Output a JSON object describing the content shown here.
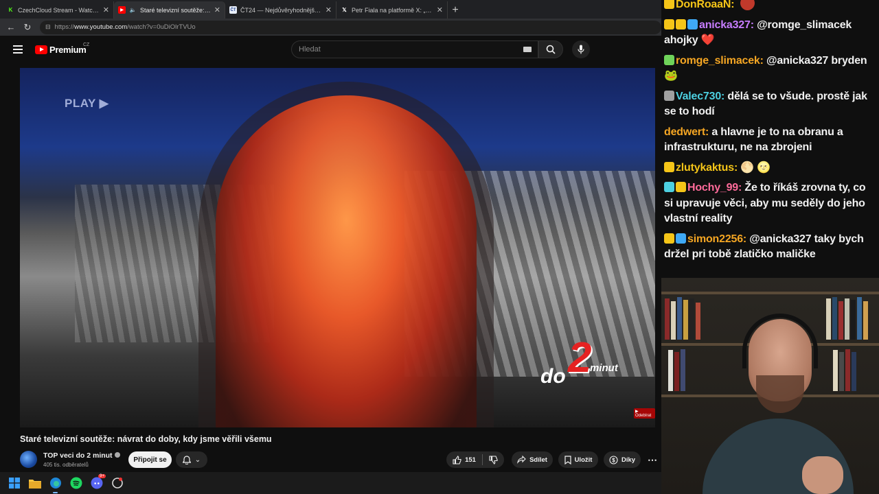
{
  "browser": {
    "tabs": [
      {
        "title": "CzechCloud Stream - Watch Live o",
        "icon": "kick-icon",
        "color": "#53fc18",
        "active": false
      },
      {
        "title": "Staré televizní soutěže: návrat",
        "icon": "youtube-icon",
        "color": "#ff0000",
        "active": true
      },
      {
        "title": "ČT24 — Nejdůvěryhodnější zprav",
        "icon": "ct24-icon",
        "color": "#4a7bd0",
        "active": false
      },
      {
        "title": "Petr Fiala na platformě X: „100 dní",
        "icon": "x-icon",
        "color": "#ffffff",
        "active": false
      }
    ],
    "url_prefix": "https://",
    "url_host": "www.youtube.com",
    "url_path": "/watch?v=0uDiOlrTVUo"
  },
  "youtube": {
    "logo_text": "Premium",
    "country": "CZ",
    "search_placeholder": "Hledat"
  },
  "video": {
    "overlay_play": "PLAY ▶",
    "logo_do": "do",
    "logo_two": "2",
    "logo_minut": "minut",
    "corner_tag": "▶ Odebírat"
  },
  "meta": {
    "title": "Staré televizní soutěže: návrat do doby, kdy jsme věřili všemu",
    "channel": "TOP veci do 2 minut",
    "subscribers": "405 tis. odběratelů",
    "join_label": "Připojit se",
    "likes": "151",
    "share_label": "Sdílet",
    "save_label": "Uložit",
    "thanks_label": "Díky"
  },
  "taskbar": {
    "discord_badge": "9+"
  },
  "chat": [
    {
      "user": "DonRoaaN",
      "color": "#f5c518",
      "badges": [
        "#f5c518"
      ],
      "text": "",
      "emote": "#c0392b"
    },
    {
      "user": "anicka327",
      "color": "#c77dff",
      "badges": [
        "#f5c518",
        "#f5c518",
        "#3fa9f5"
      ],
      "text": "@romge_slimacek ahojky ❤️"
    },
    {
      "user": "romge_slimacek",
      "color": "#f5a623",
      "badges": [
        "#6fd35a"
      ],
      "text": "@anicka327 bryden 🐸"
    },
    {
      "user": "Valec730",
      "color": "#4dd0e1",
      "badges": [
        "#a0a0a0"
      ],
      "text": "dělá se to všude. prostě jak se to hodí"
    },
    {
      "user": "dedwert",
      "color": "#f5a623",
      "badges": [],
      "text": "a hlavne je to na obranu a infrastrukturu, ne na zbrojeni"
    },
    {
      "user": "zlutykaktus",
      "color": "#f5c518",
      "badges": [
        "#f5c518"
      ],
      "text": "🌕 🌝"
    },
    {
      "user": "Hochy_99",
      "color": "#ff6b9a",
      "badges": [
        "#4dd0e1",
        "#f5c518"
      ],
      "text": "Že to říkáš zrovna ty, co si upravuje věci, aby mu seděly do jeho vlastní reality"
    },
    {
      "user": "simon2256",
      "color": "#f5a623",
      "badges": [
        "#f5c518",
        "#3fa9f5"
      ],
      "text": "@anicka327 taky bych držel pri tobě zlatičko maličke"
    }
  ]
}
